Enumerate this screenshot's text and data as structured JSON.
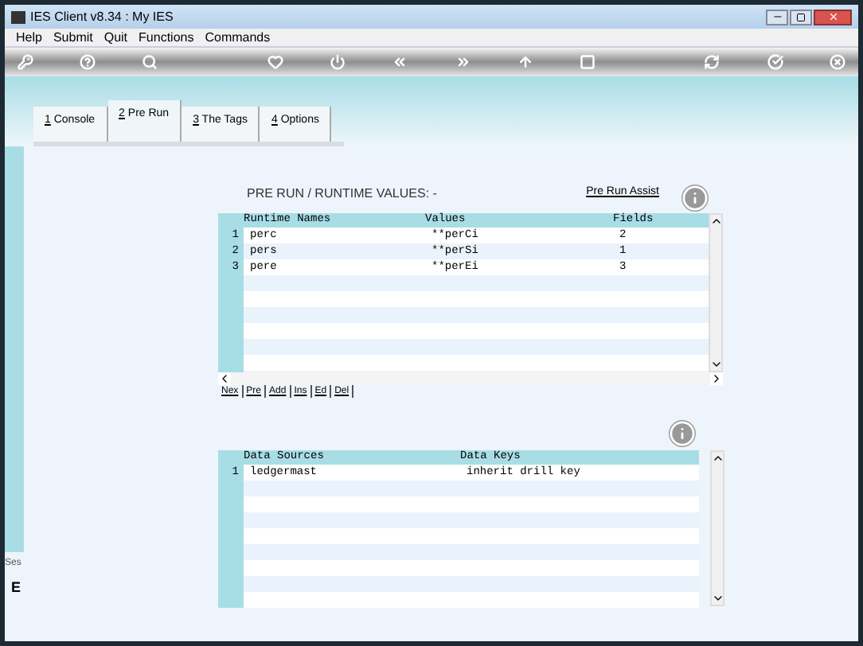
{
  "window": {
    "title": "IES Client v8.34 : My IES"
  },
  "menu": [
    "Help",
    "Submit",
    "Quit",
    "Functions",
    "Commands"
  ],
  "tabs": [
    {
      "label": "1 Console",
      "selected": false
    },
    {
      "label": "2 Pre Run",
      "selected": true
    },
    {
      "label": "3 The Tags",
      "selected": false
    },
    {
      "label": "4 Options",
      "selected": false
    }
  ],
  "heading": "PRE RUN / RUNTIME VALUES: -",
  "assist_link": "Pre Run Assist",
  "runtime_table": {
    "columns": [
      "Runtime Names",
      "Values",
      "Fields"
    ],
    "rows": [
      {
        "index": "1",
        "cells": [
          "perc",
          "**perCi",
          "2"
        ]
      },
      {
        "index": "2",
        "cells": [
          "pers",
          "**perSi",
          "1"
        ]
      },
      {
        "index": "3",
        "cells": [
          "pere",
          "**perEi",
          "3"
        ]
      }
    ]
  },
  "row_buttons": [
    "Nex",
    "Pre",
    "Add",
    "Ins",
    "Ed",
    "Del"
  ],
  "sources_table": {
    "columns": [
      "Data Sources",
      "Data Keys"
    ],
    "rows": [
      {
        "index": "1",
        "cells": [
          "ledgermast",
          "inherit drill key"
        ]
      }
    ]
  },
  "side_labels": [
    "Ses",
    "E"
  ]
}
